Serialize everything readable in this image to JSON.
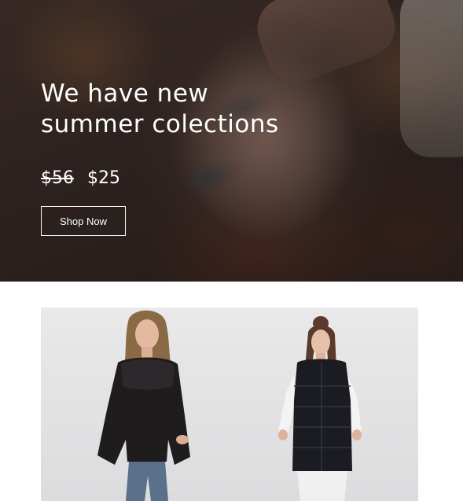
{
  "hero": {
    "title_lines": [
      "We have new",
      "summer colections"
    ],
    "price_old": "$56",
    "price_new": "$25",
    "button_label": "Shop Now",
    "text_color": "#ffffff"
  },
  "product_banner": {
    "background_color": "#e5e5e6",
    "items": [
      {
        "icon": "model-black-blouse-image"
      },
      {
        "icon": "model-black-vest-image"
      }
    ]
  }
}
